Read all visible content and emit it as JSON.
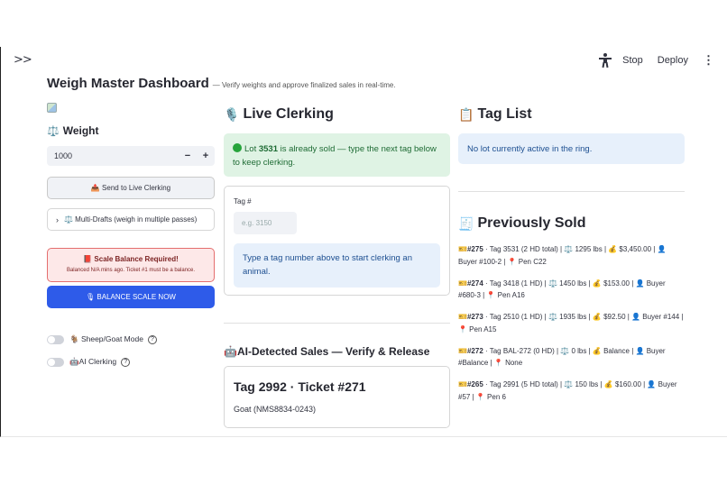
{
  "toolbar": {
    "expand_glyph": ">>",
    "stop_label": "Stop",
    "deploy_label": "Deploy",
    "menu_glyph": "⋮"
  },
  "page": {
    "title": "Weigh Master Dashboard",
    "subtitle": "— Verify weights and approve finalized sales in real-time."
  },
  "sidebar_col": {
    "weight_label": "Weight",
    "weight_icon": "⚖️",
    "weight_value": "1000",
    "minus": "−",
    "plus": "+",
    "send_button": "📤 Send to Live Clerking",
    "multidraft_label": "⚖️ Multi-Drafts (weigh in multiple passes)",
    "alert_title": "📕 Scale Balance Required!",
    "alert_detail": "Balanced N/A mins ago. Ticket #1 must be a balance.",
    "balance_button": "🎙 BALANCE SCALE NOW",
    "toggle_sheep": "🐐 Sheep/Goat Mode",
    "toggle_ai": "🤖AI Clerking",
    "help_glyph": "?"
  },
  "live_clerking": {
    "icon": "🎙️",
    "heading": "Live Clerking",
    "status_prefix": "Lot ",
    "status_lot": "3531",
    "status_suffix": " is already sold — type the next tag below to keep clerking.",
    "tag_label": "Tag #",
    "tag_placeholder": "e.g. 3150",
    "info_text": "Type a tag number above to start clerking an animal."
  },
  "ai_sales": {
    "heading": "🤖AI-Detected Sales — Verify & Release",
    "card_title": "Tag 2992 · Ticket #271",
    "card_sub": "Goat (NMS8834-0243)"
  },
  "tag_list": {
    "icon": "📋",
    "heading": "Tag List",
    "info_text": "No lot currently active in the ring."
  },
  "previously_sold": {
    "icon": "🧾",
    "heading": "Previously Sold",
    "items": [
      {
        "id": "#275",
        "text": " · Tag 3531 (2 HD total) | ⚖️ 1295 lbs | 💰 $3,450.00 | 👤 Buyer #100-2 | 📍 Pen C22"
      },
      {
        "id": "#274",
        "text": " · Tag 3418 (1 HD) | ⚖️ 1450 lbs | 💰 $153.00 | 👤 Buyer #680-3 | 📍 Pen A16"
      },
      {
        "id": "#273",
        "text": " · Tag 2510 (1 HD) | ⚖️ 1935 lbs | 💰 $92.50 | 👤 Buyer #144 | 📍 Pen A15"
      },
      {
        "id": "#272",
        "text": " · Tag BAL-272 (0 HD) | ⚖️ 0 lbs | 💰 Balance | 👤 Buyer #Balance | 📍 None"
      },
      {
        "id": "#265",
        "text": " · Tag 2991 (5 HD total) | ⚖️ 150 lbs | 💰 $160.00 | 👤 Buyer #57 | 📍 Pen 6"
      }
    ]
  },
  "colors": {
    "primary": "#2e5be9",
    "success_bg": "#dff3e4",
    "info_bg": "#e7f0fb",
    "error_bg": "#fde8e8"
  }
}
